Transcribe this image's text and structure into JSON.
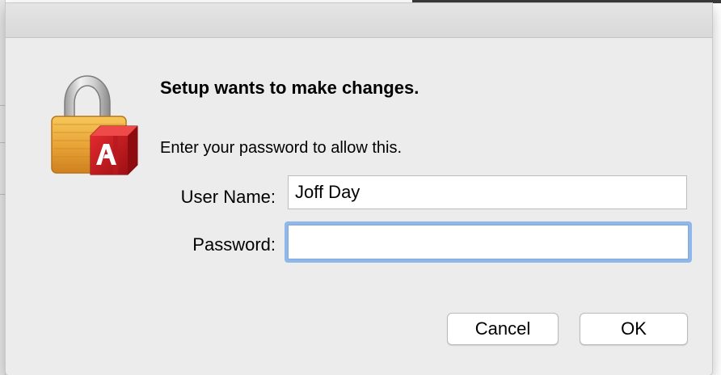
{
  "dialog": {
    "title": "Setup wants to make changes.",
    "message": "Enter your password to allow this.",
    "icon": "lock-with-adobe-package-icon"
  },
  "form": {
    "username_label": "User Name:",
    "username_value": "Joff Day",
    "password_label": "Password:",
    "password_value": ""
  },
  "buttons": {
    "cancel_label": "Cancel",
    "ok_label": "OK"
  },
  "colors": {
    "sheet_background": "#ececec",
    "focus_ring": "#8fb7ea",
    "lock_gold": "#e9a63a",
    "adobe_red": "#c8161e"
  }
}
